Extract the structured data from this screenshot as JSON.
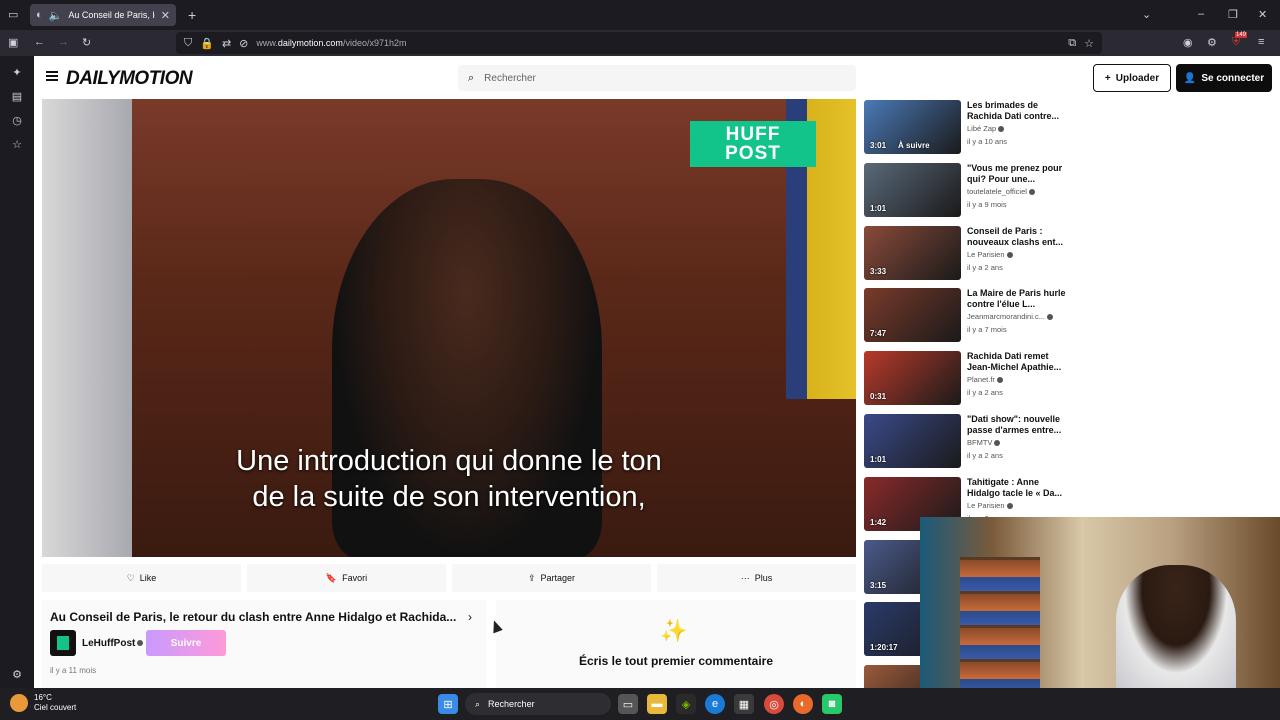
{
  "browser": {
    "tab_title": "Au Conseil de Paris, le retour",
    "url_prefix": "www.",
    "url_domain": "dailymotion.com",
    "url_path": "/video/x971h2m",
    "badge_count": "149"
  },
  "header": {
    "logo": "DAILYMOTION",
    "search_placeholder": "Rechercher",
    "upload_label": "Uploader",
    "login_label": "Se connecter"
  },
  "video": {
    "brand_line1": "HUFF",
    "brand_line2": "POST",
    "subtitle_line1": "Une introduction qui donne le ton",
    "subtitle_line2": "de la suite de son intervention,"
  },
  "actions": [
    {
      "label": "Like",
      "icon": "heart-icon"
    },
    {
      "label": "Favori",
      "icon": "bookmark-icon"
    },
    {
      "label": "Partager",
      "icon": "share-icon"
    },
    {
      "label": "Plus",
      "icon": "more-icon"
    }
  ],
  "info": {
    "title": "Au Conseil de Paris, le retour du clash entre Anne Hidalgo et Rachida...",
    "channel": "LeHuffPost",
    "follow_label": "Suivre",
    "date": "il y a 11 mois"
  },
  "comments": {
    "cta": "Écris le tout premier commentaire"
  },
  "recommendations": [
    {
      "title": "Les brimades de Rachida Dati contre...",
      "channel": "Libé Zap",
      "date": "il y a 10 ans",
      "duration": "3:01",
      "badge": "À suivre",
      "color": "#4a7ab8"
    },
    {
      "title": "\"Vous me prenez pour qui? Pour une...",
      "channel": "toutelatele_officiel",
      "date": "il y a 9 mois",
      "duration": "1:01",
      "color": "#5a6a7a"
    },
    {
      "title": "Conseil de Paris : nouveaux clashs ent...",
      "channel": "Le Parisien",
      "date": "il y a 2 ans",
      "duration": "3:33",
      "color": "#8a4a3a"
    },
    {
      "title": "La Maire de Paris hurle contre l'élue L...",
      "channel": "Jeanmarcmorandini.c...",
      "date": "il y a 7 mois",
      "duration": "7:47",
      "color": "#7a3a2a"
    },
    {
      "title": "Rachida Dati remet Jean-Michel Apathie...",
      "channel": "Planet.fr",
      "date": "il y a 2 ans",
      "duration": "0:31",
      "color": "#b83a2a"
    },
    {
      "title": "\"Dati show\": nouvelle passe d'armes entre...",
      "channel": "BFMTV",
      "date": "il y a 2 ans",
      "duration": "1:01",
      "color": "#3a4a8a"
    },
    {
      "title": "Tahitigate : Anne Hidalgo tacle le « Da...",
      "channel": "Le Parisien",
      "date": "il y a 2 ans",
      "duration": "1:42",
      "color": "#8a2a2a"
    },
    {
      "title": "",
      "channel": "",
      "date": "",
      "duration": "3:15",
      "color": "#4a5a8a"
    },
    {
      "title": "",
      "channel": "",
      "date": "",
      "duration": "1:20:17",
      "color": "#2a3a6a"
    },
    {
      "title": "",
      "channel": "",
      "date": "",
      "duration": "",
      "color": "#9a5a3a"
    }
  ],
  "taskbar": {
    "temperature": "16°C",
    "weather": "Ciel couvert",
    "search": "Rechercher"
  }
}
